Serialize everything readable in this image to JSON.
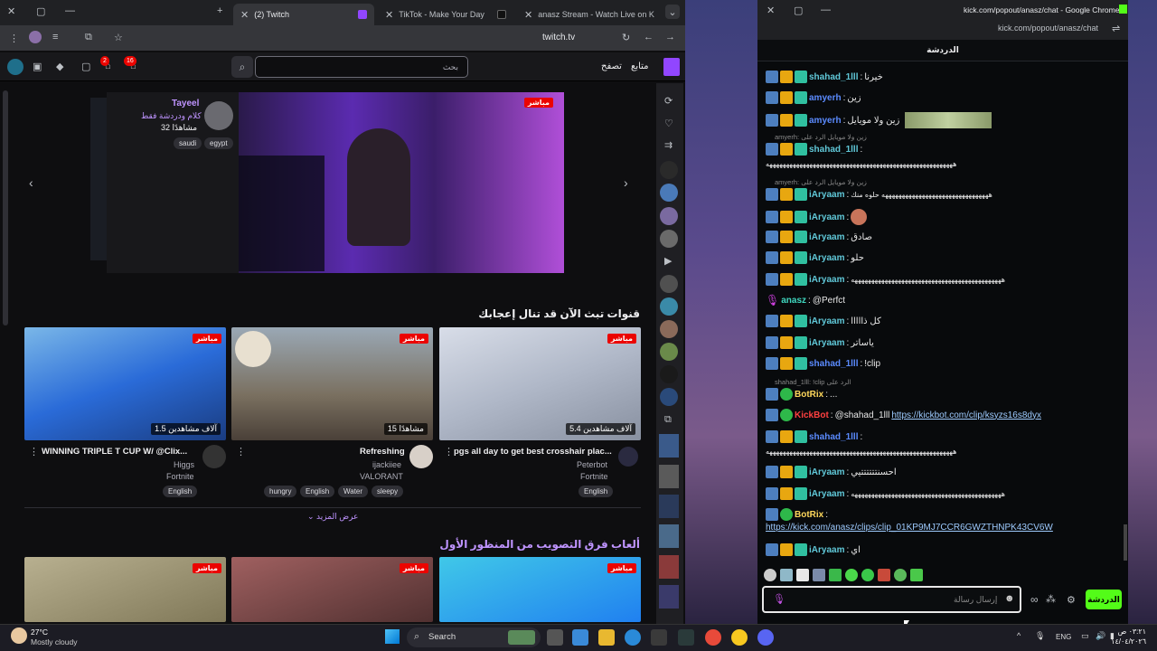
{
  "browser": {
    "tabs": [
      {
        "label": "(2) Twitch",
        "active": true,
        "icon_color": "#9146ff"
      },
      {
        "label": "TikTok - Make Your Day",
        "active": false,
        "icon_color": "#111111"
      },
      {
        "label": "anasz Stream - Watch Live on K",
        "active": false,
        "icon_color": "#53fc18"
      }
    ],
    "url": "twitch.tv"
  },
  "twitch": {
    "nav": {
      "following": "متابع",
      "browse": "تصفح"
    },
    "search_placeholder": "بحث",
    "notifications": {
      "inbox": "2",
      "whispers": "16"
    },
    "carousel": {
      "streamer": "Tayeel",
      "title": "كلام ودردشة فقط",
      "viewers": "32 مشاهدًا",
      "live": "مباشر",
      "tags": [
        "egypt",
        "saudi"
      ]
    },
    "section1_title": "قنوات تبث الآن قد تنال إعجابك",
    "section1_title_highlight": "قنوات تبث الآن",
    "cards": [
      {
        "live": "مباشر",
        "viewers": "1.5 آلاف مشاهدين",
        "title": "WINNING TRIPLE T CUP W/ @Clix...",
        "channel": "Higgs",
        "game": "Fortnite",
        "tags": [
          "English"
        ]
      },
      {
        "live": "مباشر",
        "viewers": "15 مشاهدًا",
        "title": "Refreshing",
        "channel": "ijackiiee",
        "game": "VALORANT",
        "tags": [
          "hungry",
          "English",
          "Water",
          "sleepy"
        ]
      },
      {
        "live": "مباشر",
        "viewers": "5.4 آلاف مشاهدين",
        "title": "pgs all day to get best crosshair plac...",
        "channel": "Peterbot",
        "game": "Fortnite",
        "tags": [
          "English"
        ]
      }
    ],
    "show_more": "عرض المزيد",
    "section2_title": "ألعاب فرق التصويب من المنظور الأول",
    "row2_live": "مباشر"
  },
  "kick_window": {
    "title": "kick.com/popout/anasz/chat - Google Chrome",
    "url": "kick.com/popout/anasz/chat",
    "header": "الدردشة",
    "messages": [
      {
        "user": "shahad_1lll",
        "text": "خيرنا",
        "color": "teal"
      },
      {
        "user": "amyerh",
        "text": "زين",
        "color": "blue"
      },
      {
        "user": "amyerh",
        "text": "زين ولا مويايل",
        "color": "blue"
      },
      {
        "reply": "amyerh: زين ولا مويايل  الرد على"
      },
      {
        "user": "shahad_1lll",
        "text": "",
        "color": "teal"
      },
      {
        "text_only": "ههههههههههههههههههههههههههههههههههههههههههههههههههههههههه"
      },
      {
        "reply": "amyerh: زين ولا مويايل  الرد على"
      },
      {
        "user": "iAryaam",
        "text": "ههههههههههههههههههههههههههههههههه حلوه منك",
        "color": "teal"
      },
      {
        "user": "iAryaam",
        "text": "",
        "color": "teal"
      },
      {
        "user": "iAryaam",
        "text": "صادق",
        "color": "teal"
      },
      {
        "user": "iAryaam",
        "text": "حلو",
        "color": "teal"
      },
      {
        "user": "iAryaam",
        "text": "هههههههههههههههههههههههههههههههههههههههههههههه",
        "color": "teal"
      },
      {
        "user": "anasz",
        "text": "@Perfct",
        "color": "teal"
      },
      {
        "user": "iAryaam",
        "text": "كل ذااااا",
        "color": "teal"
      },
      {
        "user": "iAryaam",
        "text": "ياساتر",
        "color": "teal"
      },
      {
        "user": "shahad_1lll",
        "text": "!clip",
        "color": "blue"
      },
      {
        "reply": "shahad_1lll: !clip  الرد على"
      },
      {
        "user": "BotRix",
        "text": "...",
        "color": "teal"
      },
      {
        "user": "KickBot",
        "text": "@shahad_1lll",
        "link": "https://kickbot.com/clip/ksyzs16s8dyx",
        "color": "red"
      },
      {
        "user": "shahad_1lll",
        "text": "",
        "color": "blue"
      },
      {
        "text_only": "ههههههههههههههههههههههههههههههههههههههههههههههههههههههههه"
      },
      {
        "user": "iAryaam",
        "text": "احسنتتتتتتيي",
        "color": "teal"
      },
      {
        "user": "iAryaam",
        "text": "هههههههههههههههههههههههههههههههههههههههههههههه",
        "color": "teal"
      },
      {
        "user": "BotRix",
        "text": "",
        "color": "teal"
      },
      {
        "link_only": "https://kick.com/anasz/clips/clip_01KP9MJ7CCR6GWZTHNPK43CV6W"
      },
      {
        "user": "iAryaam",
        "text": "اي",
        "color": "teal"
      }
    ],
    "input_placeholder": "إرسال رسالة",
    "send_button": "الدردشة"
  },
  "taskbar": {
    "weather_temp": "27°C",
    "weather_desc": "Mostly cloudy",
    "search": "Search",
    "lang": "ENG",
    "time": "٠٣:٢١ ص",
    "date": "١٤/٠٤/٢٠٢٦"
  }
}
